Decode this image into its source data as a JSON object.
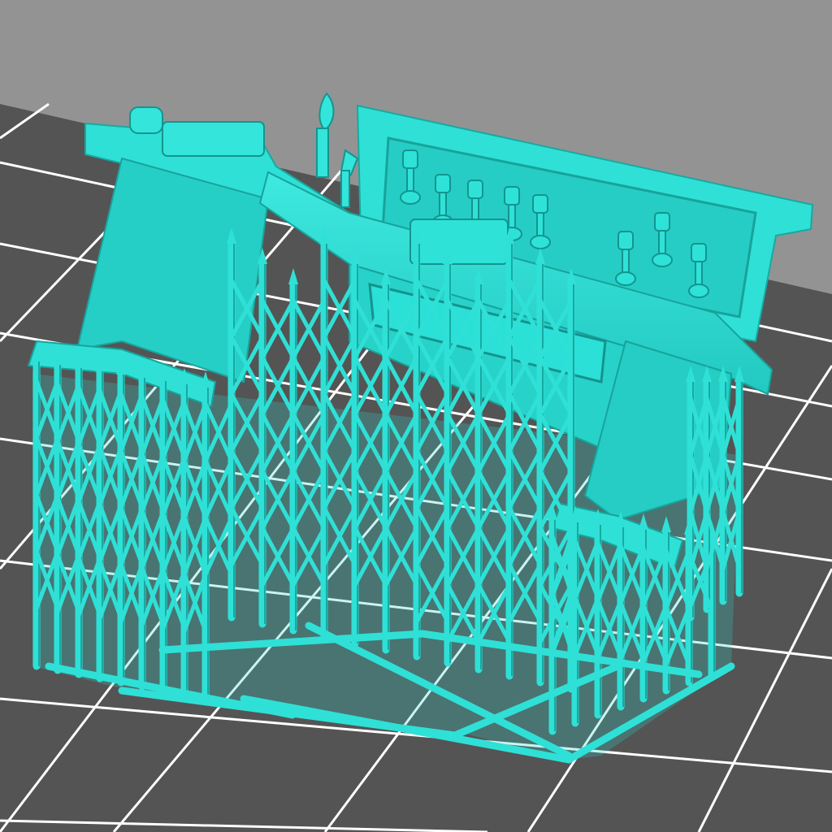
{
  "viewport": {
    "name": "3d-print-preview",
    "background_color": "#939393",
    "build_plate_color": "#545454",
    "grid_line_color": "#ffffff",
    "model_color": "#2fe0d6",
    "model_shadow_color": "#1a9e98",
    "model_highlight_color": "#7ff5ef"
  },
  "model": {
    "object": "workbench-on-supports",
    "support_structure": "lattice-tree-supports"
  }
}
